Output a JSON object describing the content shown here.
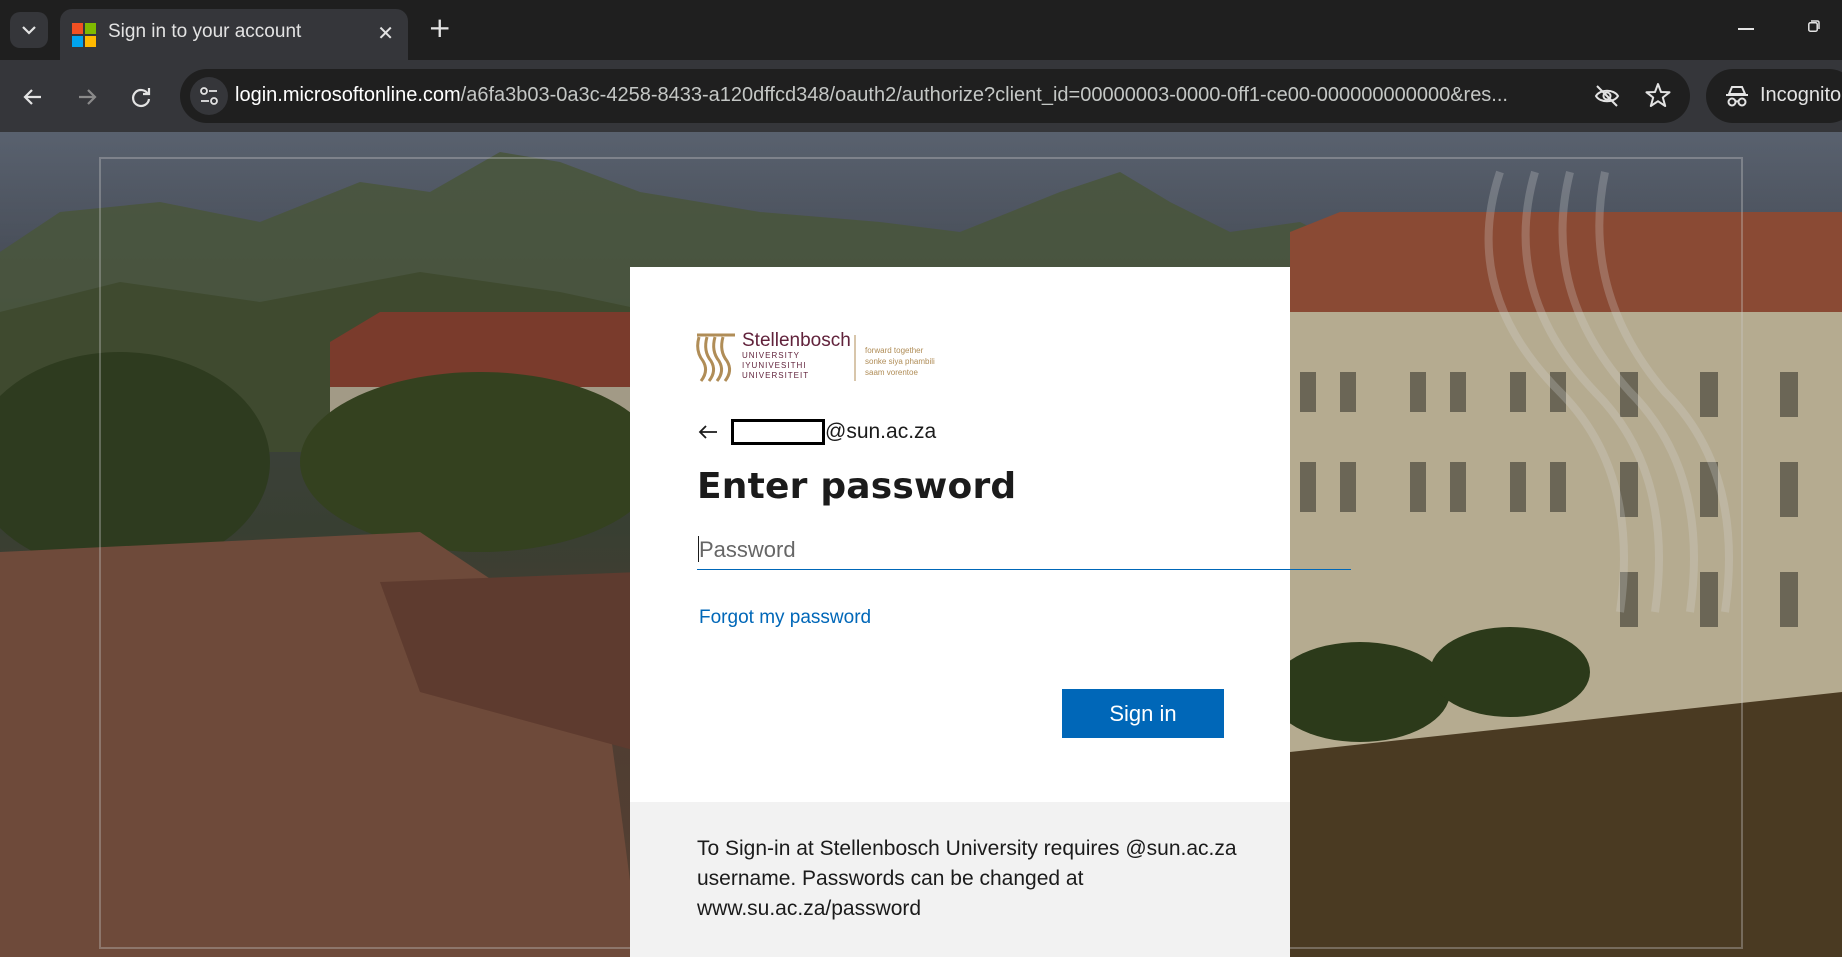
{
  "browser": {
    "tab_title": "Sign in to your account",
    "url_host": "login.microsoftonline.com",
    "url_path": "/a6fa3b03-0a3c-4258-8433-a120dffcd348/oauth2/authorize?client_id=00000003-0000-0ff1-ce00-000000000000&res...",
    "incognito_label": "Incognito"
  },
  "brand": {
    "name": "Stellenbosch",
    "sub_lines": [
      "UNIVERSITY",
      "IYUNIVESITHI",
      "UNIVERSITEIT"
    ],
    "tagline_lines": [
      "forward together",
      "sonke siya phambili",
      "saam vorentoe"
    ],
    "primary_color": "#61223b",
    "gold_color": "#b08d57"
  },
  "login": {
    "account_domain": "@sun.ac.za",
    "heading": "Enter password",
    "password_placeholder": "Password",
    "forgot_link": "Forgot my password",
    "signin_button": "Sign in",
    "accent_color": "#0067b8"
  },
  "footer": {
    "text": "To Sign-in at Stellenbosch University requires @sun.ac.za username. Passwords can be changed at www.su.ac.za/password"
  }
}
